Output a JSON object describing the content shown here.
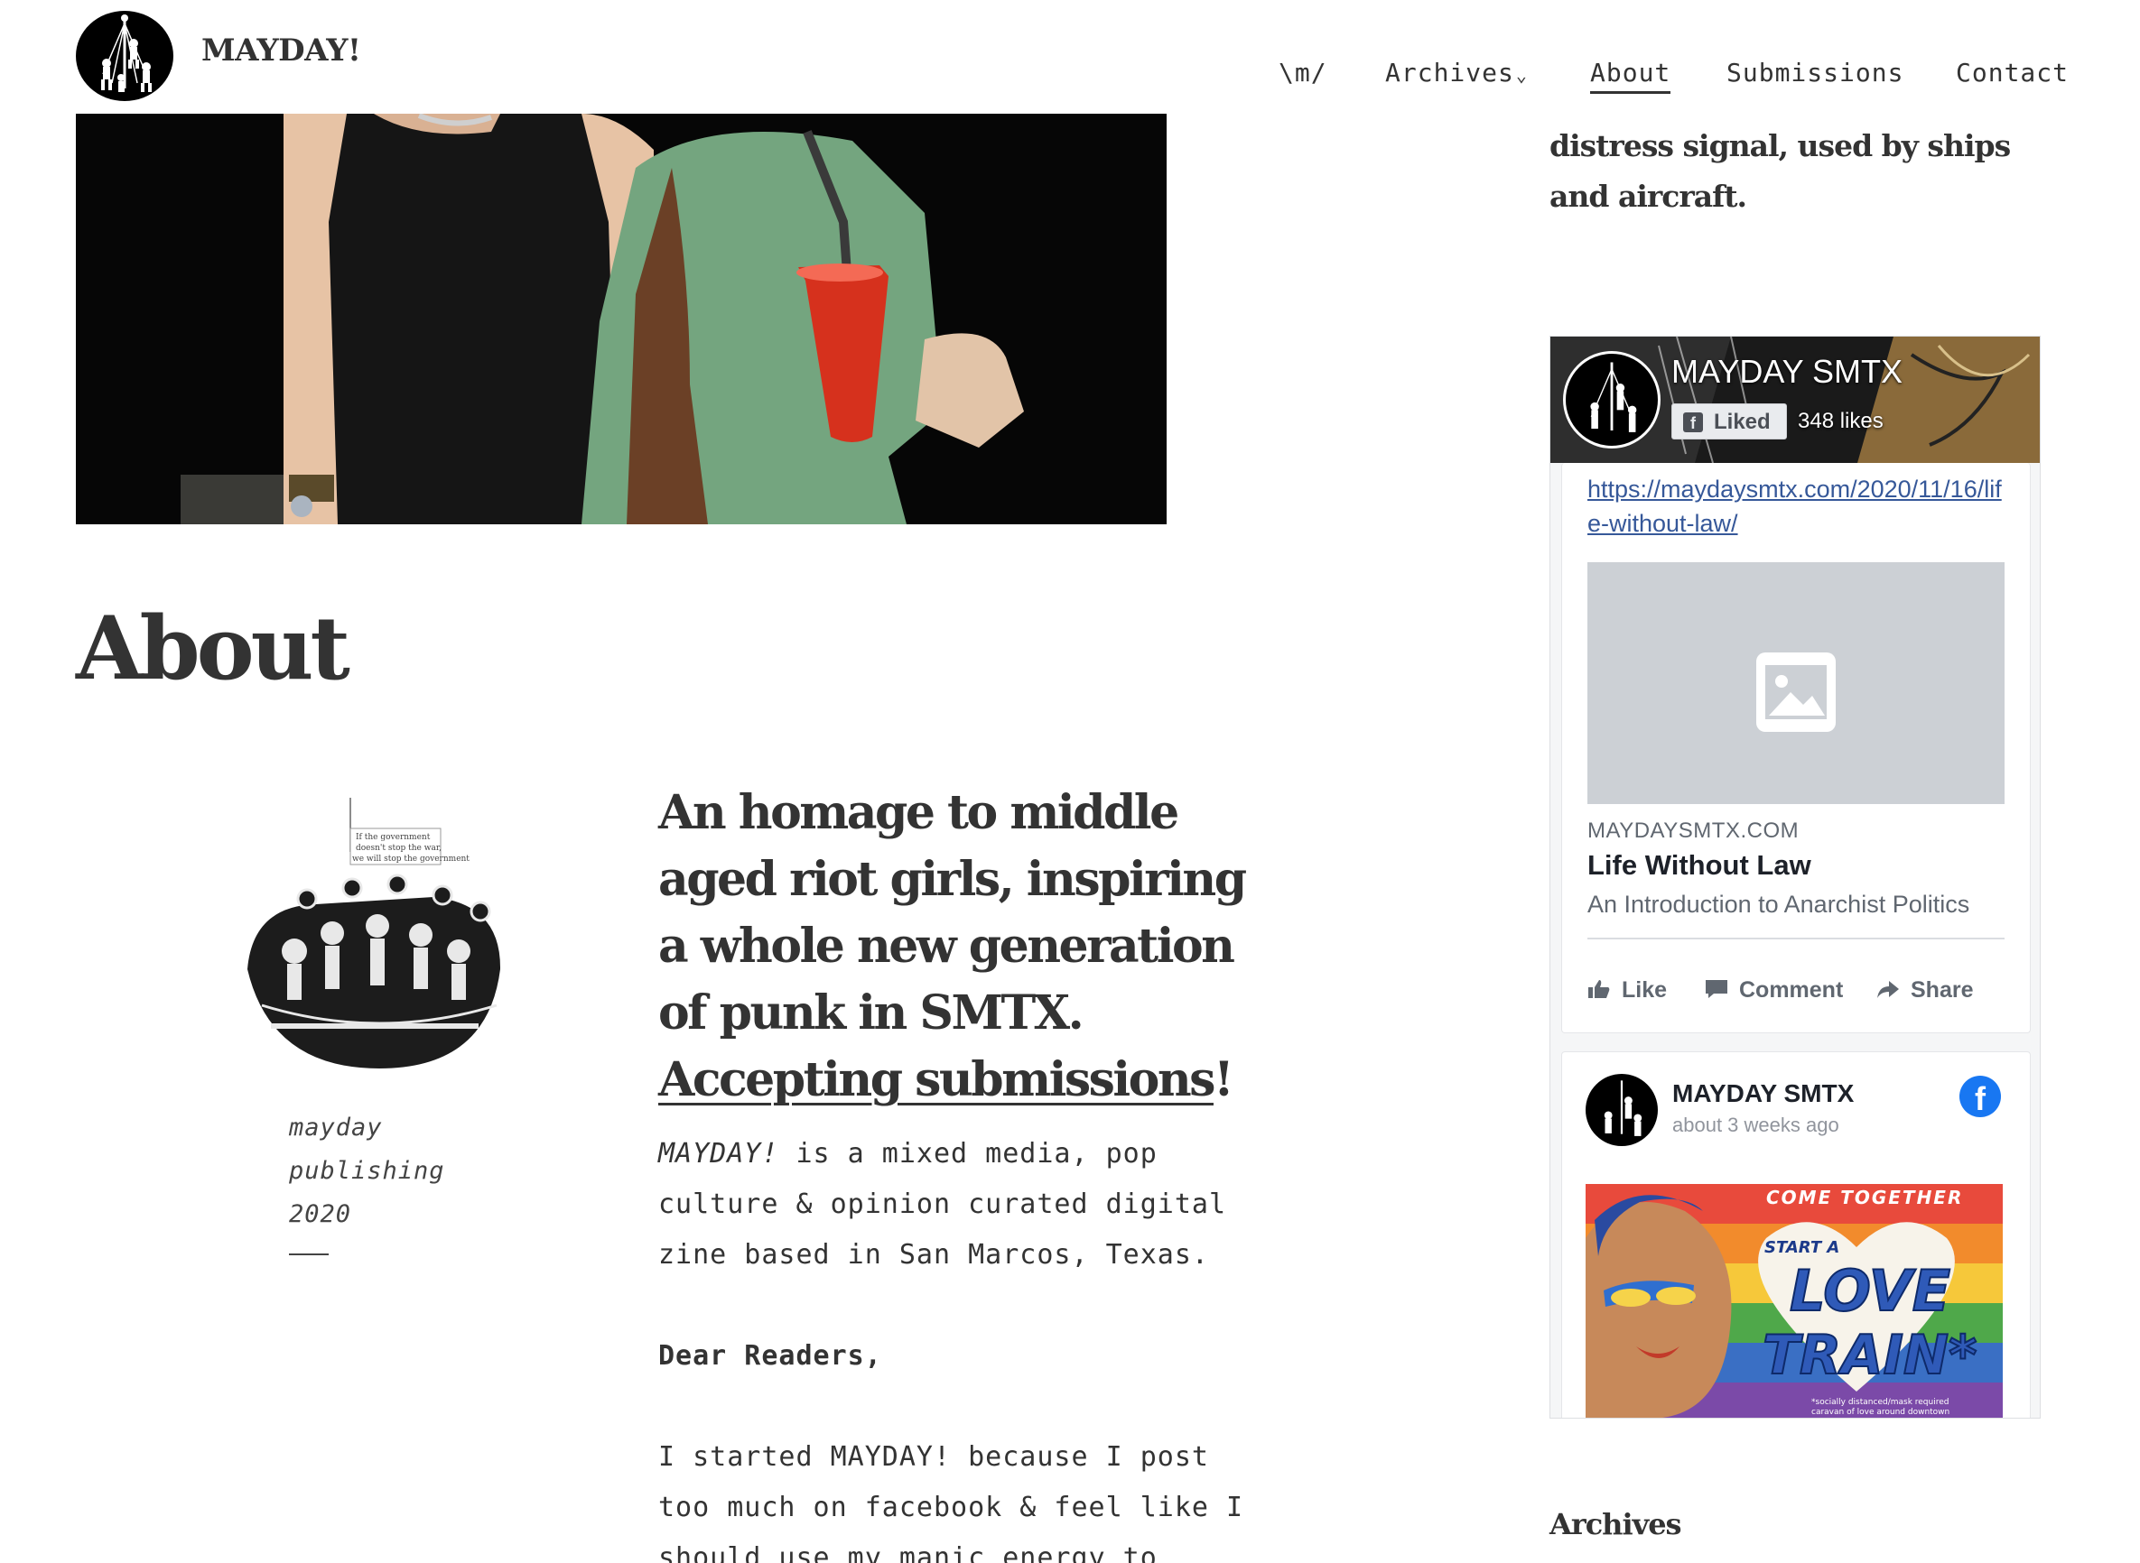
{
  "header": {
    "site_title": "MAYDAY!",
    "logo_icon": "mayday-figures-logo-icon",
    "nav": [
      {
        "label": "\\m/"
      },
      {
        "label": "Archives",
        "icon": "chevron-down-icon"
      },
      {
        "label": "About",
        "active": true
      },
      {
        "label": "Submissions"
      },
      {
        "label": "Contact"
      }
    ]
  },
  "main": {
    "page_title": "About",
    "byline": {
      "line1": "mayday",
      "line2": "publishing",
      "line3": "2020"
    },
    "collage_text": {
      "line1": "If the government",
      "line2": "doesn't stop the war,",
      "line3": "we will stop the government"
    },
    "lead_text": "An homage to middle aged riot girls, inspiring a whole new generation of punk in SMTX. ",
    "lead_link": "Accepting submissions",
    "lead_end": "!",
    "intro_em": "MAYDAY!",
    "intro_rest": " is a mixed media, pop culture & opinion curated digital zine based in San Marcos, Texas.",
    "greeting": "Dear Readers,",
    "paragraph": "I started MAYDAY! because I post too much on facebook & feel like I should use my manic energy to"
  },
  "sidebar": {
    "intro_text": "distress signal, used by ships and aircraft.",
    "archives_heading": "Archives",
    "facebook": {
      "page_name": "MAYDAY SMTX",
      "liked_label": "Liked",
      "likes": "348 likes",
      "link_url": "https://maydaysmtx.com/2020/11/16/life-without-law/",
      "link_domain": "MAYDAYSMTX.COM",
      "link_title": "Life Without Law",
      "link_desc": "An Introduction to Anarchist Politics",
      "actions": {
        "like": "Like",
        "comment": "Comment",
        "share": "Share"
      },
      "post_name": "MAYDAY SMTX",
      "post_time": "about 3 weeks ago",
      "poster": {
        "top": "COME TOGETHER",
        "start": "START A",
        "love": "LOVE",
        "train": "TRAIN*",
        "footnote1": "*socially distanced/mask required",
        "footnote2": "caravan of love around downtown"
      },
      "colors": {
        "link": "#365899",
        "brand": "#1877f2"
      }
    }
  }
}
